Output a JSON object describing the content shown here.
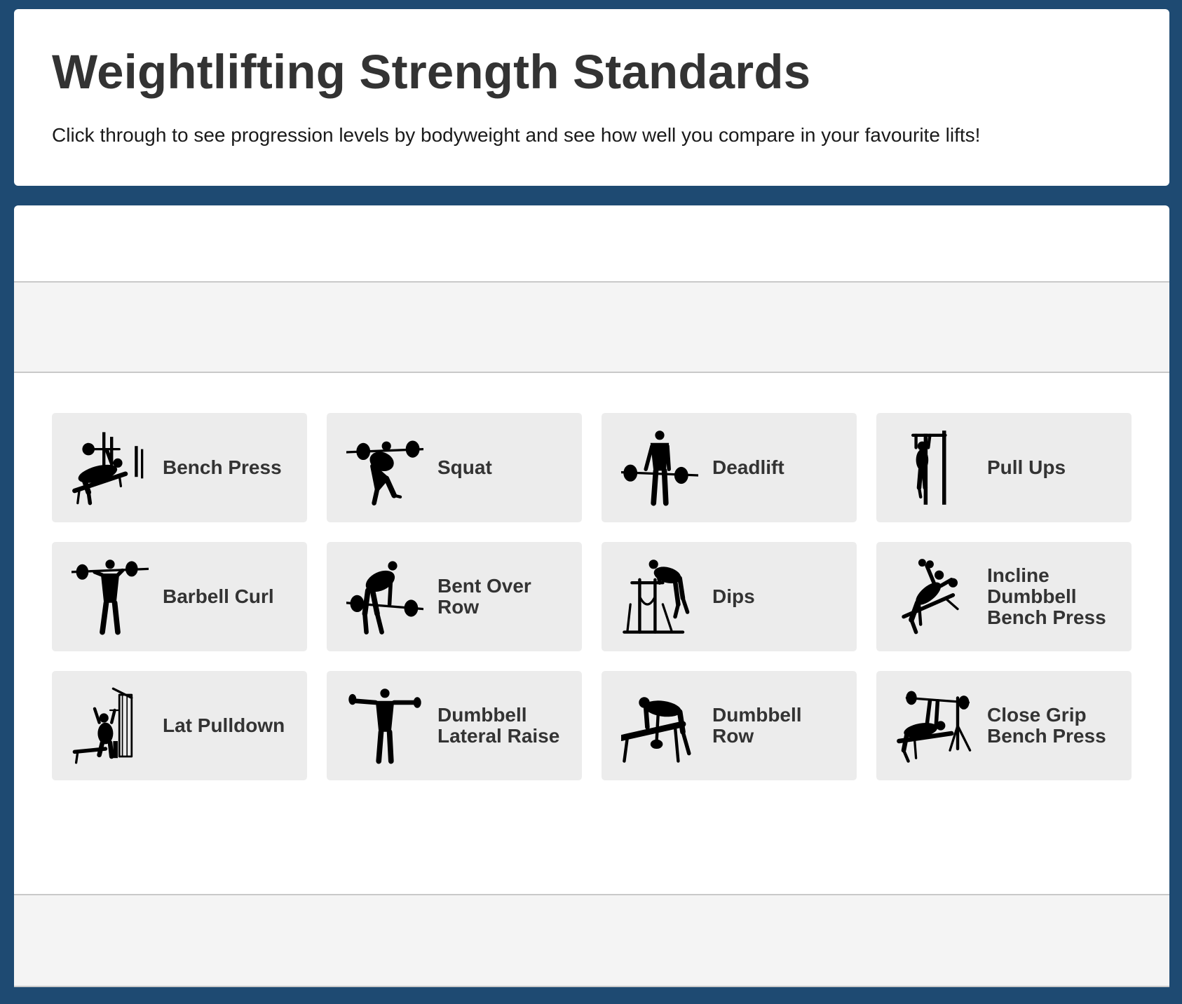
{
  "header": {
    "title": "Weightlifting Strength Standards",
    "subtitle": "Click through to see progression levels by bodyweight and see how well you compare in your favourite lifts!"
  },
  "lifts": [
    {
      "label": "Bench Press",
      "icon": "bench-press-icon"
    },
    {
      "label": "Squat",
      "icon": "squat-icon"
    },
    {
      "label": "Deadlift",
      "icon": "deadlift-icon"
    },
    {
      "label": "Pull Ups",
      "icon": "pull-ups-icon"
    },
    {
      "label": "Barbell Curl",
      "icon": "barbell-curl-icon"
    },
    {
      "label": "Bent Over Row",
      "icon": "bent-over-row-icon"
    },
    {
      "label": "Dips",
      "icon": "dips-icon"
    },
    {
      "label": "Incline Dumbbell Bench Press",
      "icon": "incline-dumbbell-bench-press-icon"
    },
    {
      "label": "Lat Pulldown",
      "icon": "lat-pulldown-icon"
    },
    {
      "label": "Dumbbell Lateral Raise",
      "icon": "dumbbell-lateral-raise-icon"
    },
    {
      "label": "Dumbbell Row",
      "icon": "dumbbell-row-icon"
    },
    {
      "label": "Close Grip Bench Press",
      "icon": "close-grip-bench-press-icon"
    }
  ],
  "colors": {
    "page_background": "#1e4a72",
    "card_background": "#ffffff",
    "tile_background": "#ececec",
    "band_background": "#f4f4f4",
    "text": "#333333"
  }
}
